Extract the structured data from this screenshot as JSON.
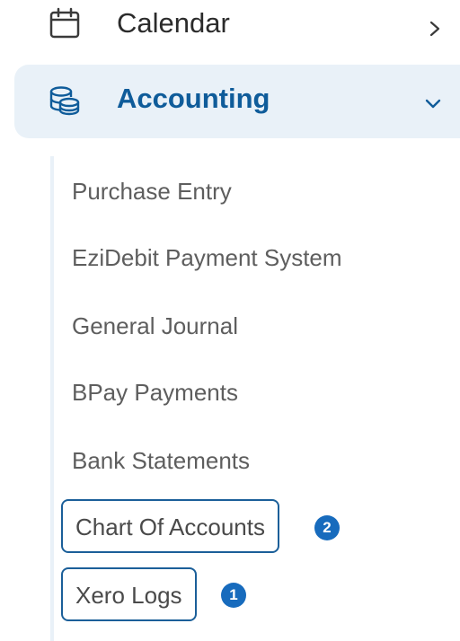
{
  "nav": {
    "calendar": {
      "label": "Calendar",
      "icon": "calendar-icon",
      "chevron": "chevron-right-icon"
    },
    "accounting": {
      "label": "Accounting",
      "icon": "database-icon",
      "chevron": "chevron-down-icon",
      "expanded": true,
      "items": [
        {
          "label": "Purchase Entry"
        },
        {
          "label": "EziDebit Payment System"
        },
        {
          "label": "General Journal"
        },
        {
          "label": "BPay Payments"
        },
        {
          "label": "Bank Statements"
        },
        {
          "label": "Chart Of Accounts",
          "badge": "2"
        },
        {
          "label": "Xero Logs",
          "badge": "1"
        }
      ]
    }
  },
  "colors": {
    "accent": "#0f5c9a",
    "active_bg": "#e9f1f8",
    "badge": "#176bbd",
    "highlight_border": "#1b5f99"
  }
}
